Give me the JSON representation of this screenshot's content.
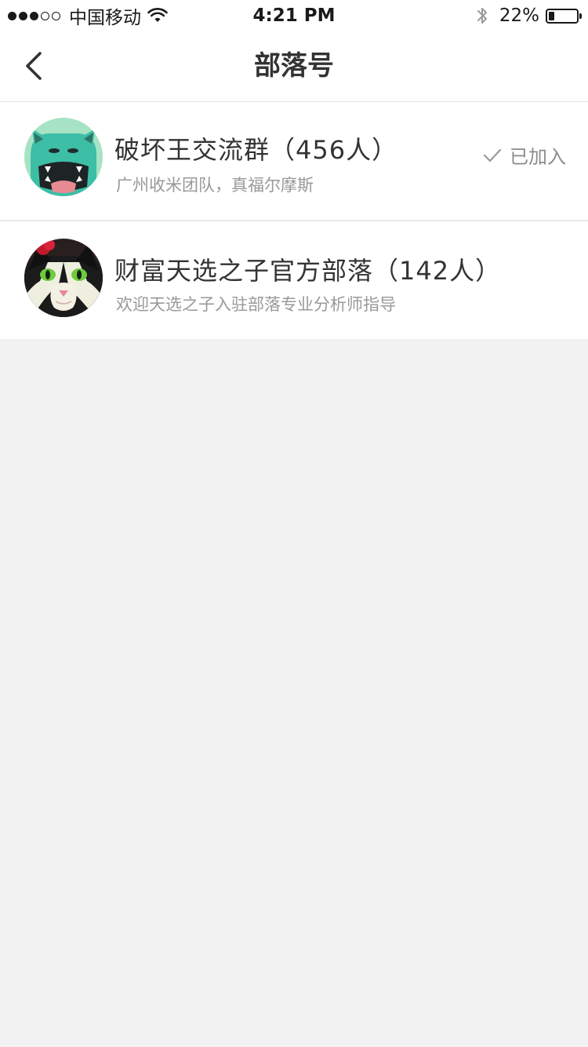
{
  "status_bar": {
    "carrier": "中国移动",
    "time": "4:21 PM",
    "battery_percent": "22%",
    "battery_level": 0.22,
    "signal_bars_filled": 3,
    "signal_bars_total": 5
  },
  "nav": {
    "title": "部落号"
  },
  "tribes": [
    {
      "name": "破坏王交流群（456人）",
      "description": "广州收米团队，真福尔摩斯",
      "status": "已加入",
      "avatar_icon": "teal-monster-avatar"
    },
    {
      "name": "财富天选之子官方部落（142人）",
      "description": "欢迎天选之子入驻部落专业分析师指导",
      "avatar_icon": "black-white-cat-avatar"
    }
  ],
  "colors": {
    "background": "#f2f2f2",
    "card": "#ffffff",
    "title_text": "#333333",
    "secondary_text": "#999999",
    "divider": "#e8e8e8"
  }
}
